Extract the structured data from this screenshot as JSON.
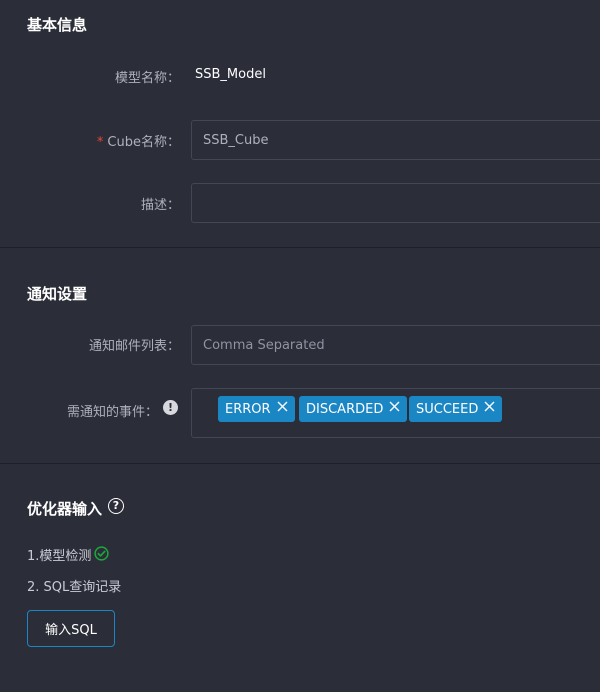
{
  "basic_info": {
    "title": "基本信息",
    "model_name_label": "模型名称：",
    "model_name_value": "SSB_Model",
    "cube_name_required": "*",
    "cube_name_label": "Cube名称：",
    "cube_name_value": "SSB_Cube",
    "description_label": "描述：",
    "description_value": ""
  },
  "notify": {
    "title": "通知设置",
    "email_label": "通知邮件列表：",
    "email_placeholder": "Comma Separated",
    "events_label": "需通知的事件：",
    "info_icon": "!",
    "tags": [
      {
        "label": "ERROR"
      },
      {
        "label": "DISCARDED"
      },
      {
        "label": "SUCCEED"
      }
    ]
  },
  "optimizer": {
    "title": "优化器输入",
    "help_icon": "?",
    "steps": [
      {
        "label": "1.模型检测",
        "status": "done"
      },
      {
        "label": "2. SQL查询记录"
      }
    ],
    "input_sql_button": "输入SQL"
  },
  "colors": {
    "accent": "#1b86c4",
    "success": "#1ea83c",
    "required": "#e8453c",
    "background": "#2b2d38"
  }
}
